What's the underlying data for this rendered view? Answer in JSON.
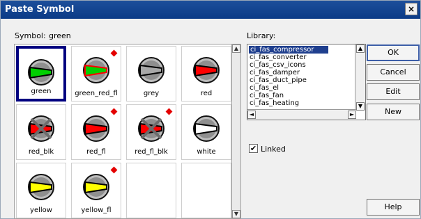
{
  "window": {
    "title": "Paste Symbol"
  },
  "symbol": {
    "label": "Symbol:",
    "value": "green"
  },
  "library": {
    "label": "Library:",
    "items": [
      "ci_fas_compressor",
      "ci_fas_converter",
      "ci_fas_csv_icons",
      "ci_fas_damper",
      "ci_fas_duct_pipe",
      "ci_fas_el",
      "ci_fas_fan",
      "ci_fas_heating"
    ],
    "selected_index": 0
  },
  "linked": {
    "label": "Linked",
    "checked": true
  },
  "buttons": {
    "ok": "OK",
    "cancel": "Cancel",
    "edit": "Edit",
    "new": "New",
    "help": "Help"
  },
  "symbols": [
    {
      "name": "green",
      "icon": "green-valve-icon",
      "selected": true
    },
    {
      "name": "green_red_fl",
      "icon": "green-red-flash-valve-icon",
      "flag": true
    },
    {
      "name": "grey",
      "icon": "grey-valve-icon"
    },
    {
      "name": "red",
      "icon": "red-valve-icon"
    },
    {
      "name": "red_blk",
      "icon": "red-block-valve-icon"
    },
    {
      "name": "red_fl",
      "icon": "red-flash-valve-icon",
      "flag": true
    },
    {
      "name": "red_fl_blk",
      "icon": "red-flash-block-valve-icon",
      "flag": true
    },
    {
      "name": "white",
      "icon": "white-valve-icon"
    },
    {
      "name": "yellow",
      "icon": "yellow-valve-icon"
    },
    {
      "name": "yellow_fl",
      "icon": "yellow-flash-valve-icon",
      "flag": true
    },
    {
      "name": "",
      "icon": ""
    },
    {
      "name": "",
      "icon": ""
    }
  ],
  "colors": {
    "green": "#00d000",
    "red": "#ff0000",
    "grey": "#a8a8a8",
    "yellow": "#ffff00",
    "white": "#ffffff",
    "highlight": "#1f3f8e"
  }
}
